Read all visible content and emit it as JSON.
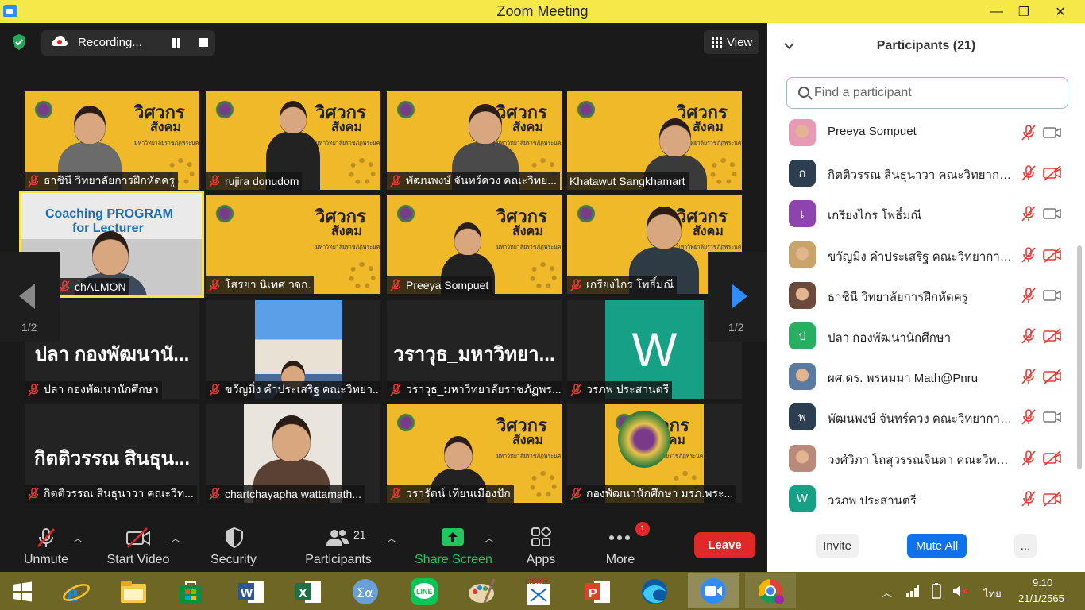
{
  "window": {
    "title": "Zoom Meeting",
    "minimize": "—",
    "maximize": "❐",
    "close": "✕"
  },
  "top_bar": {
    "recording_label": "Recording...",
    "view_label": "View"
  },
  "pager": {
    "left": "1/2",
    "right": "1/2"
  },
  "tiles": [
    {
      "name": "ธาชินี  วิทยาลัยการฝึกหัดครู"
    },
    {
      "name": "rujira donudom"
    },
    {
      "name": "พัฒนพงษ์ จันทร์ควง คณะวิทย..."
    },
    {
      "name": "Khatawut Sangkhamart",
      "mic_visible": false
    },
    {
      "name": "chALMON",
      "slide_line1": "Coaching PROGRAM",
      "slide_line2": "for Lecturer",
      "active": true
    },
    {
      "name": "โสรยา นิเทศ วจก."
    },
    {
      "name": "Preeya Sompuet"
    },
    {
      "name": "เกรียงไกร โพธิ์มณี"
    },
    {
      "name": "ปลา  กองพัฒนานักศึกษา",
      "big_name": "ปลา  กองพัฒนานั..."
    },
    {
      "name": "ขวัญมิ่ง คำประเสริฐ คณะวิทยา..."
    },
    {
      "name": "วราวุธ_มหาวิทยาลัยราชภัฏพร...",
      "big_name": "วราวุธ_มหาวิทยา..."
    },
    {
      "name": "วรภพ ประสานตรี",
      "letter": "W"
    },
    {
      "name": "กิตติวรรณ สินธุนาวา คณะวิท...",
      "big_name": "กิตติวรรณ สินธุน..."
    },
    {
      "name": "chartchayapha wattamath..."
    },
    {
      "name": "วรารัตน์ เทียนเมืองปัก"
    },
    {
      "name": "กองพัฒนานักศึกษา มรภ.พระ..."
    }
  ],
  "slide_branding": {
    "title_glyph": "วิศวกร",
    "subtitle_glyph": "สังคม",
    "caption": "มหาวิทยาลัยราชภัฏพระนคร"
  },
  "toolbar": {
    "unmute": "Unmute",
    "start_video": "Start Video",
    "security": "Security",
    "participants": "Participants",
    "participants_count": "21",
    "share_screen": "Share Screen",
    "apps": "Apps",
    "more": "More",
    "more_badge": "1",
    "leave": "Leave",
    "colors": {
      "share": "#22c55e",
      "leave": "#e02828"
    }
  },
  "panel": {
    "title": "Participants (21)",
    "search_placeholder": "Find a participant",
    "participants": [
      {
        "name": "Preeya Sompuet",
        "avatar_type": "photo",
        "video": "on",
        "color": "#e79ab5"
      },
      {
        "name": "กิตติวรรณ สินธุนาวา คณะวิทยาการจัด...",
        "initial": "ก",
        "color": "#2c3e50",
        "video": "off"
      },
      {
        "name": "เกรียงไกร โพธิ์มณี",
        "initial": "เ",
        "color": "#8e44ad",
        "video": "on"
      },
      {
        "name": "ขวัญมิ่ง คำประเสริฐ คณะวิทยาการจัดก...",
        "avatar_type": "photo",
        "color": "#c8a36a",
        "video": "off"
      },
      {
        "name": "ธาชินี  วิทยาลัยการฝึกหัดครู",
        "avatar_type": "photo",
        "color": "#6a4a3a",
        "video": "on"
      },
      {
        "name": "ปลา  กองพัฒนานักศึกษา",
        "initial": "ป",
        "color": "#27ae60",
        "video": "off"
      },
      {
        "name": "ผศ.ดร. พรหมมา Math@Pnru",
        "avatar_type": "photo",
        "color": "#5a7aa0",
        "video": "off"
      },
      {
        "name": "พัฒนพงษ์ จันทร์ควง คณะวิทยาการจัด...",
        "initial": "พ",
        "color": "#2c3e50",
        "video": "on"
      },
      {
        "name": "วงศ์วิภา โถสุวรรณจินดา คณะวิทยาการ...",
        "avatar_type": "photo",
        "color": "#b98a7a",
        "video": "off"
      },
      {
        "name": "วรภพ ประสานตรี",
        "initial": "W",
        "color": "#16a085",
        "video": "off"
      }
    ],
    "invite": "Invite",
    "mute_all": "Mute All",
    "more": "..."
  },
  "taskbar": {
    "apps": [
      "start",
      "internet-explorer",
      "file-explorer",
      "store",
      "word",
      "excel",
      "math-input",
      "line",
      "paint",
      "lisrel",
      "powerpoint",
      "edge",
      "zoom",
      "chrome"
    ],
    "lisrel_label": "LISREL",
    "lang": "ไทย",
    "time": "9:10",
    "date": "21/1/2565"
  }
}
